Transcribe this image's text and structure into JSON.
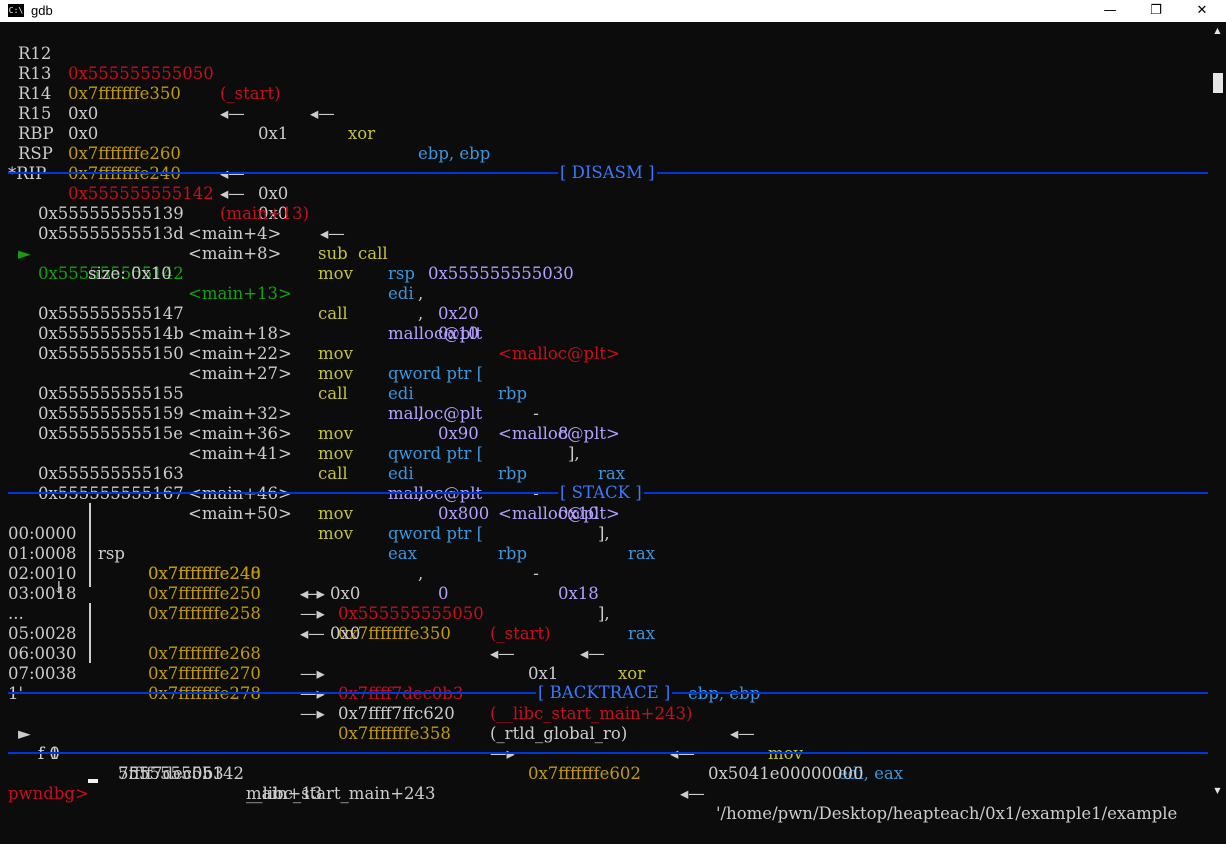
{
  "window": {
    "title": "gdb",
    "app_icon": "terminal-icon",
    "minimize": "—",
    "maximize": "❐",
    "close": "✕"
  },
  "registers": [
    {
      "name": "R12",
      "value": "0x555555555050",
      "sym": "(_start)",
      "arrow": "◂—",
      "insn": "xor",
      "ops": "ebp, ebp"
    },
    {
      "name": "R13",
      "value": "0x7fffffffe350",
      "arrow": "◂—",
      "target": "0x1"
    },
    {
      "name": "R14",
      "value": "0x0"
    },
    {
      "name": "R15",
      "value": "0x0"
    },
    {
      "name": "RBP",
      "value": "0x7fffffffe260",
      "arrow": "◂—",
      "target": "0x0"
    },
    {
      "name": "RSP",
      "value": "0x7fffffffe240",
      "arrow": "◂—",
      "target": "0x0"
    },
    {
      "name": "*RIP",
      "value": "0x555555555142",
      "sym": "(main+13)",
      "arrow": "◂—",
      "insn": "call",
      "ops": "0x555555555030"
    }
  ],
  "sections": {
    "disasm": "[ DISASM ]",
    "stack": "[ STACK ]",
    "backtrace": "[ BACKTRACE ]"
  },
  "disasm": [
    {
      "addr": "0x555555555139",
      "sym": "<main+4>",
      "op": "sub",
      "a": "rsp",
      "sep": ", ",
      "b": "0x20"
    },
    {
      "addr": "0x55555555513d",
      "sym": "<main+8>",
      "op": "mov",
      "a": "edi",
      "sep": ", ",
      "b": "0x10"
    },
    {
      "marker": "►",
      "addr": "0x555555555142",
      "sym": "<main+13>",
      "op": "call",
      "a": "malloc@plt",
      "target": "<malloc@plt>"
    },
    {
      "extra": "size: 0x10"
    },
    {
      "addr": "0x555555555147",
      "sym": "<main+18>",
      "op": "mov",
      "a": "qword ptr [",
      "reg": "rbp",
      "minus": " - ",
      "off": "8",
      "close": "], ",
      "b": "rax"
    },
    {
      "addr": "0x55555555514b",
      "sym": "<main+22>",
      "op": "mov",
      "a": "edi",
      "sep": ", ",
      "b": "0x90"
    },
    {
      "addr": "0x555555555150",
      "sym": "<main+27>",
      "op": "call",
      "a": "malloc@plt",
      "target": "<malloc@plt>"
    },
    {
      "addr": "0x555555555155",
      "sym": "<main+32>",
      "op": "mov",
      "a": "qword ptr [",
      "reg": "rbp",
      "minus": " - ",
      "off": "0x10",
      "close": "], ",
      "b": "rax"
    },
    {
      "addr": "0x555555555159",
      "sym": "<main+36>",
      "op": "mov",
      "a": "edi",
      "sep": ", ",
      "b": "0x800"
    },
    {
      "addr": "0x55555555515e",
      "sym": "<main+41>",
      "op": "call",
      "a": "malloc@plt",
      "target": "<malloc@plt>"
    },
    {
      "addr": "0x555555555163",
      "sym": "<main+46>",
      "op": "mov",
      "a": "qword ptr [",
      "reg": "rbp",
      "minus": " - ",
      "off": "0x18",
      "close": "], ",
      "b": "rax"
    },
    {
      "addr": "0x555555555167",
      "sym": "<main+50>",
      "op": "mov",
      "a": "eax",
      "sep": ", ",
      "b": "0"
    }
  ],
  "stack": [
    {
      "idx": "00:0000",
      "reg": "rsp",
      "addr": "0x7fffffffe240",
      "rest": "◂— 0x0"
    },
    {
      "idx": "01:0008",
      "addr": "0x7fffffffe248",
      "ptr": "—▸",
      "val": "0x555555555050",
      "sym": "(_start)",
      "arrow": "◂—",
      "insn": "xor",
      "ops": "ebp, ebp"
    },
    {
      "idx": "02:0010",
      "addr": "0x7fffffffe250",
      "ptr": "—▸",
      "val": "0x7fffffffe350",
      "arrow": "◂—",
      "target": "0x1"
    },
    {
      "idx": "03:0018",
      "addr": "0x7fffffffe258",
      "rest": "◂— 0x0"
    },
    {
      "idx": "...",
      "skip": "↓"
    },
    {
      "idx": "05:0028",
      "addr": "0x7fffffffe268",
      "ptr": "—▸",
      "val": "0x7ffff7dec0b3",
      "sym": "(__libc_start_main+243)",
      "arrow": "◂—",
      "insn": "mov",
      "ops": "edi, eax"
    },
    {
      "idx": "06:0030",
      "addr": "0x7fffffffe270",
      "ptr": "—▸",
      "val": "0x7ffff7ffc620",
      "sym": "(_rtld_global_ro)",
      "arrow": "◂—",
      "target": "0x5041e00000000"
    },
    {
      "idx": "07:0038",
      "addr": "0x7fffffffe278",
      "ptr": "—▸",
      "val": "0x7fffffffe358",
      "ptr2": "—▸",
      "val2": "0x7fffffffe602",
      "arrow": "◂—",
      "str": "'/home/pwn/Desktop/heapteach/0x1/example1/example",
      "str2": "1'"
    }
  ],
  "backtrace": [
    {
      "marker": "►",
      "frame": "f 0",
      "addr": "555555555142",
      "sym": "main+13"
    },
    {
      "frame": "f 1",
      "addr": "7ffff7dec0b3",
      "sym": "__libc_start_main+243"
    }
  ],
  "prompt": {
    "label": "pwndbg>",
    "input": ""
  },
  "colors": {
    "background": "#0c0c0c",
    "text": "#cccccc",
    "red": "#c50f1f",
    "yellow": "#c19c00",
    "green": "#13a10e",
    "cyan": "#3a96dd",
    "purple": "#b4a0ff",
    "separator": "#0037da"
  }
}
